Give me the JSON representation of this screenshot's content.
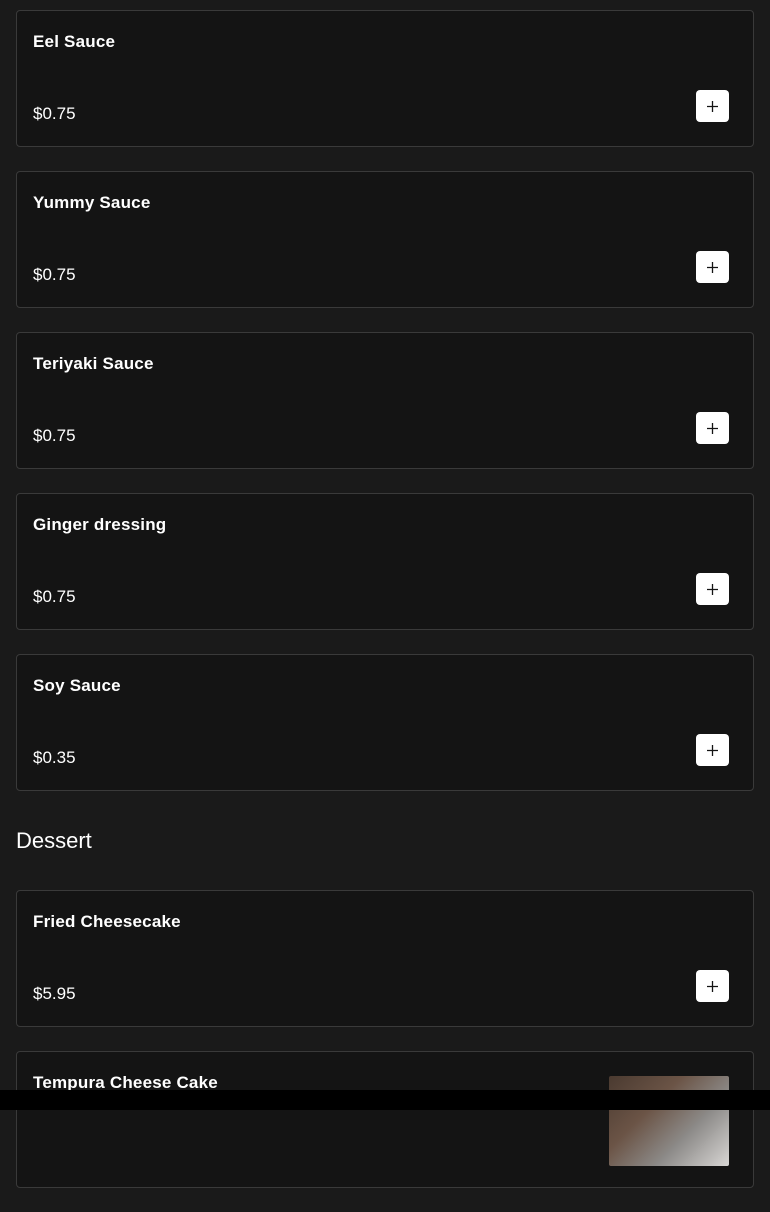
{
  "sauces": [
    {
      "name": "Eel Sauce",
      "price": "$0.75"
    },
    {
      "name": "Yummy Sauce",
      "price": "$0.75"
    },
    {
      "name": "Teriyaki Sauce",
      "price": "$0.75"
    },
    {
      "name": "Ginger dressing",
      "price": "$0.75"
    },
    {
      "name": "Soy Sauce",
      "price": "$0.35"
    }
  ],
  "dessert": {
    "section_title": "Dessert",
    "items": [
      {
        "name": "Fried Cheesecake",
        "price": "$5.95"
      },
      {
        "name": "Tempura Cheese Cake"
      }
    ]
  },
  "icons": {
    "add": "plus-icon"
  },
  "colors": {
    "background": "#1a1a1a",
    "card": "#141414",
    "card_border": "#3a3a3a",
    "button": "#ffffff",
    "text": "#ffffff"
  }
}
